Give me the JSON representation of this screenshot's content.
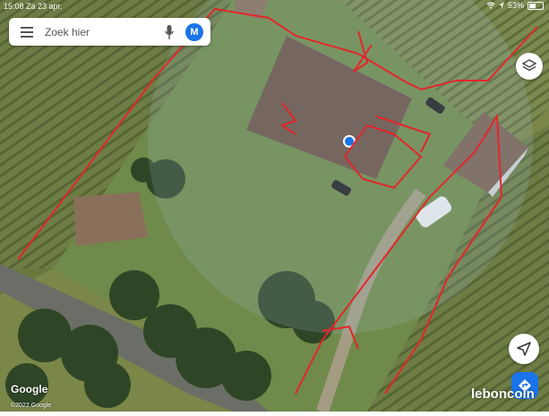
{
  "status_bar": {
    "time_date": "15:08  Za 23 apr.",
    "battery_text": "53%",
    "battery_level": 0.53
  },
  "search": {
    "placeholder": "Zoek hier",
    "avatar_letter": "M"
  },
  "map": {
    "attribution_logo": "Google",
    "copyright": "©2022 Google",
    "colors": {
      "accent": "#1a73e8",
      "annotation": "#e3262a",
      "location_dot": "#1a73e8"
    }
  },
  "watermark": {
    "text": "leboncoin"
  },
  "icons": {
    "menu": "menu-icon",
    "mic": "mic-icon",
    "layers": "layers-icon",
    "locate": "navigation-arrow-icon",
    "directions": "directions-icon",
    "wifi": "wifi-icon"
  }
}
